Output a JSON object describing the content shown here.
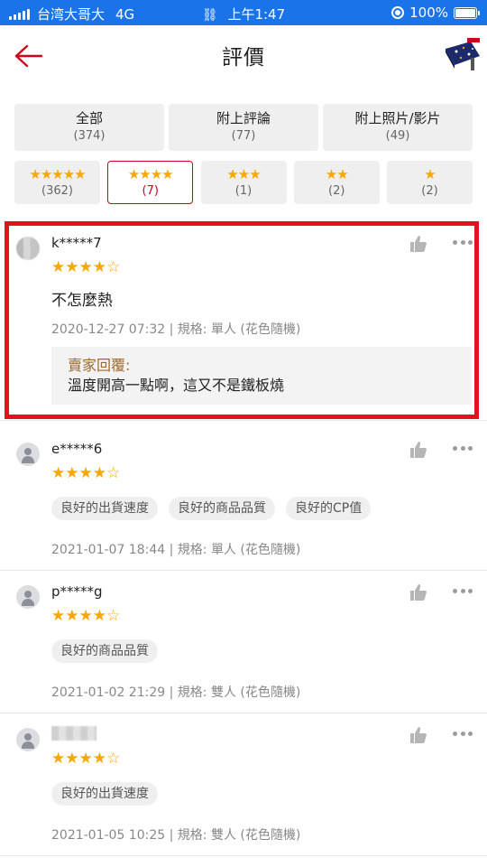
{
  "status_bar": {
    "carrier": "台湾大哥大",
    "network": "4G",
    "time": "上午1:47",
    "battery": "100%"
  },
  "header": {
    "title": "評價",
    "back_icon": "back-arrow-icon"
  },
  "filters": {
    "row1": [
      {
        "label": "全部",
        "count": "(374)"
      },
      {
        "label": "附上評論",
        "count": "(77)"
      },
      {
        "label": "附上照片/影片",
        "count": "(49)"
      }
    ],
    "row2": [
      {
        "stars": "★★★★★",
        "count": "(362)",
        "active": false
      },
      {
        "stars": "★★★★",
        "count": "(7)",
        "active": true
      },
      {
        "stars": "★★★",
        "count": "(1)",
        "active": false
      },
      {
        "stars": "★★",
        "count": "(2)",
        "active": false
      },
      {
        "stars": "★",
        "count": "(2)",
        "active": false
      }
    ]
  },
  "reviews": [
    {
      "username": "k*****7",
      "rating": 4,
      "stars_filled": "★★★★",
      "stars_empty": "☆",
      "comment": "不怎麼熱",
      "meta": "2020-12-27 07:32 | 規格: 單人 (花色隨機)",
      "seller_reply_title": "賣家回覆:",
      "seller_reply_text": "溫度開高一點啊，這又不是鐵板燒"
    },
    {
      "username": "e*****6",
      "rating": 4,
      "stars_filled": "★★★★",
      "stars_empty": "☆",
      "tags": [
        "良好的出貨速度",
        "良好的商品品質",
        "良好的CP值"
      ],
      "meta": "2021-01-07 18:44 | 規格: 單人 (花色隨機)"
    },
    {
      "username": "p*****g",
      "rating": 4,
      "stars_filled": "★★★★",
      "stars_empty": "☆",
      "tags": [
        "良好的商品品質"
      ],
      "meta": "2021-01-02 21:29 | 規格: 雙人 (花色隨機)"
    },
    {
      "username": "",
      "rating": 4,
      "stars_filled": "★★★★",
      "stars_empty": "☆",
      "tags": [
        "良好的出貨速度"
      ],
      "meta": "2021-01-05 10:25 | 規格: 雙人 (花色隨機)"
    }
  ],
  "colors": {
    "accent": "#d0011b",
    "star": "#f6a700",
    "status_bar": "#1a73e8",
    "highlight": "#e3121e"
  }
}
